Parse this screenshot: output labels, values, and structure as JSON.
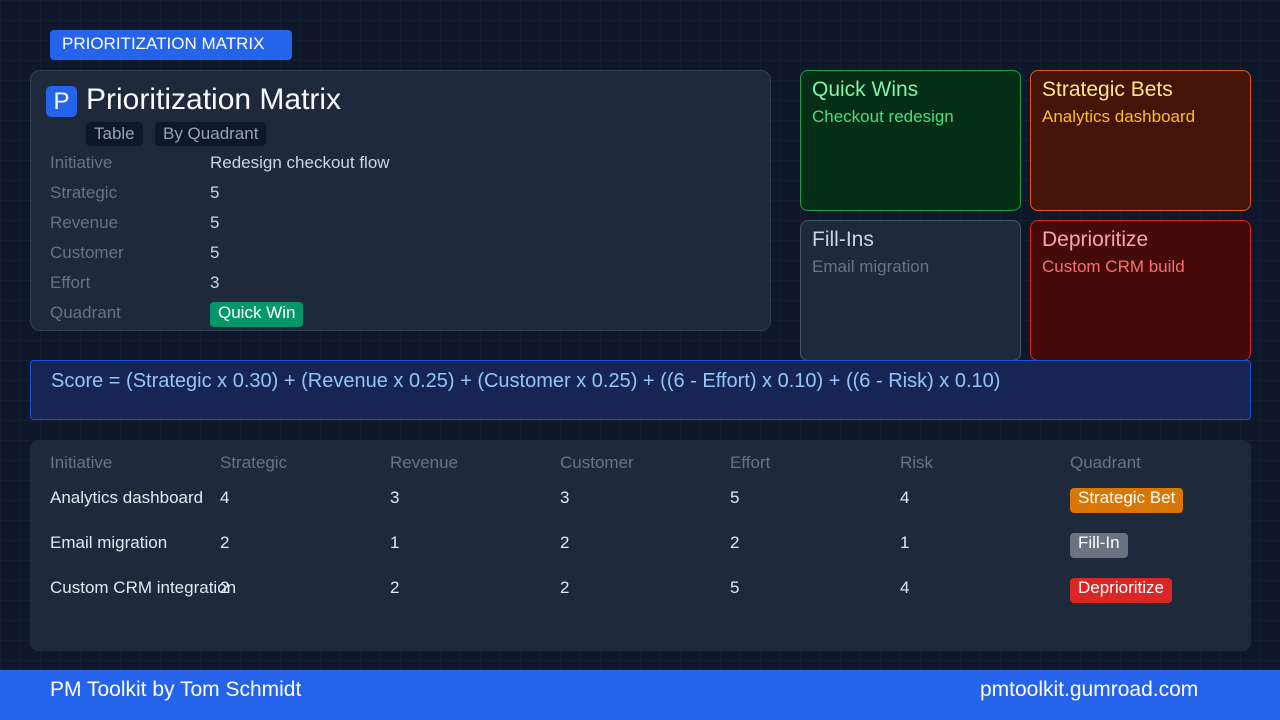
{
  "header": {
    "badge": "PRIORITIZATION MATRIX"
  },
  "detail": {
    "logo_letter": "P",
    "title": "Prioritization Matrix",
    "tabs": [
      {
        "label": "Table"
      },
      {
        "label": "By Quadrant"
      }
    ],
    "fields": [
      {
        "label": "Initiative",
        "value": "Redesign checkout flow"
      },
      {
        "label": "Strategic",
        "value": "5"
      },
      {
        "label": "Revenue",
        "value": "5"
      },
      {
        "label": "Customer",
        "value": "5"
      },
      {
        "label": "Effort",
        "value": "3"
      },
      {
        "label": "Quadrant",
        "value": "Quick Win"
      }
    ]
  },
  "quadrants": [
    {
      "title": "Quick Wins",
      "item": "Checkout redesign"
    },
    {
      "title": "Strategic Bets",
      "item": "Analytics dashboard"
    },
    {
      "title": "Fill-Ins",
      "item": "Email migration"
    },
    {
      "title": "Deprioritize",
      "item": "Custom CRM build"
    }
  ],
  "formula": "Score = (Strategic x 0.30) + (Revenue x 0.25) + (Customer x 0.25) + ((6 - Effort) x 0.10) + ((6 - Risk) x 0.10)",
  "table": {
    "headers": [
      "Initiative",
      "Strategic",
      "Revenue",
      "Customer",
      "Effort",
      "Risk",
      "Quadrant"
    ],
    "rows": [
      {
        "initiative": "Analytics dashboard",
        "strategic": "4",
        "revenue": "3",
        "customer": "3",
        "effort": "5",
        "risk": "4",
        "quadrant": "Strategic Bet"
      },
      {
        "initiative": "Email migration",
        "strategic": "2",
        "revenue": "1",
        "customer": "2",
        "effort": "2",
        "risk": "1",
        "quadrant": "Fill-In"
      },
      {
        "initiative": "Custom CRM integration",
        "strategic": "2",
        "revenue": "2",
        "customer": "2",
        "effort": "5",
        "risk": "4",
        "quadrant": "Deprioritize"
      }
    ]
  },
  "footer": {
    "left": "PM Toolkit by Tom Schmidt",
    "right": "pmtoolkit.gumroad.com"
  },
  "colors": {
    "accent": "#2563eb",
    "quick_win": "#059669",
    "strategic_bet": "#d97706",
    "fill_in": "#6b7280",
    "deprioritize": "#dc2626"
  }
}
